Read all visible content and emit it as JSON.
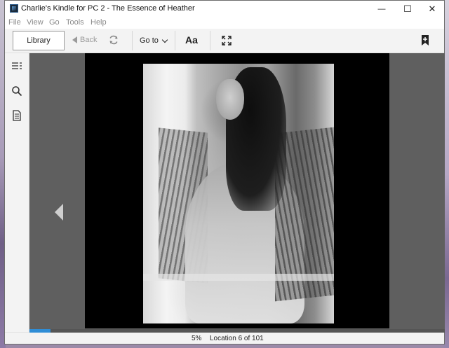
{
  "window": {
    "title": "Charlie's Kindle for PC 2 - The Essence of Heather",
    "controls": {
      "minimize": "—",
      "maximize": "☐",
      "close": "✕"
    }
  },
  "menu": [
    "File",
    "View",
    "Go",
    "Tools",
    "Help"
  ],
  "toolbar": {
    "library_label": "Library",
    "back_label": "Back",
    "goto_label": "Go to",
    "font_label": "Aa",
    "icons": [
      "sync-icon",
      "fullscreen-icon",
      "bookmark-icon"
    ]
  },
  "sidebar": {
    "icons": [
      "table-of-contents-icon",
      "search-icon",
      "notes-icon"
    ]
  },
  "reader": {
    "page_image": "black-and-white portrait photo"
  },
  "status": {
    "percent": "5%",
    "location": "Location 6 of 101",
    "progress_fraction": 0.05
  },
  "colors": {
    "accent": "#2f8dd6",
    "reader_bg": "#5f5f5f",
    "page_bg": "#000000"
  }
}
